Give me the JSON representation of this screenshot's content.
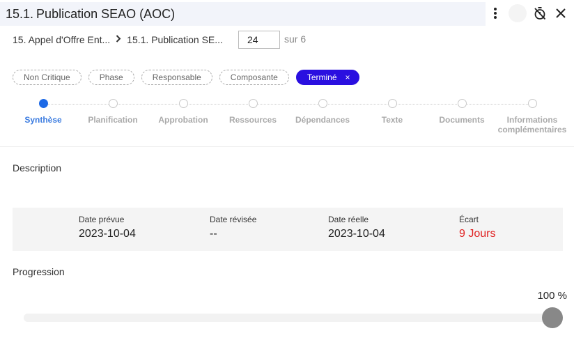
{
  "header": {
    "number": "15.1.",
    "title": "Publication SEAO (AOC)"
  },
  "icons": {
    "more": "more-vertical-icon",
    "timer_off": "timer-off-icon",
    "close": "close-icon"
  },
  "breadcrumb": {
    "items": [
      "15. Appel d'Offre Ent...",
      "15.1. Publication SE..."
    ]
  },
  "pagination": {
    "current": "24",
    "of_label": "sur 6"
  },
  "chips": [
    {
      "label": "Non Critique",
      "active": false
    },
    {
      "label": "Phase",
      "active": false
    },
    {
      "label": "Responsable",
      "active": false
    },
    {
      "label": "Composante",
      "active": false
    },
    {
      "label": "Terminé",
      "active": true,
      "remove": "×"
    }
  ],
  "steps": [
    {
      "label": "Synthèse",
      "active": true
    },
    {
      "label": "Planification",
      "active": false
    },
    {
      "label": "Approbation",
      "active": false
    },
    {
      "label": "Ressources",
      "active": false
    },
    {
      "label": "Dépendances",
      "active": false
    },
    {
      "label": "Texte",
      "active": false
    },
    {
      "label": "Documents",
      "active": false
    },
    {
      "label": "Informations complémentaires",
      "active": false
    }
  ],
  "description": {
    "label": "Description"
  },
  "dates": [
    {
      "label": "Date prévue",
      "value": "2023-10-04"
    },
    {
      "label": "Date révisée",
      "value": "--"
    },
    {
      "label": "Date réelle",
      "value": "2023-10-04"
    },
    {
      "label": "Écart",
      "value": "9 Jours",
      "color": "#e02020"
    }
  ],
  "progress": {
    "label": "Progression",
    "value": 100,
    "display": "100 %"
  },
  "colors": {
    "accent": "#2a0fe0",
    "step_active": "#1e6ae6",
    "danger": "#e02020"
  }
}
